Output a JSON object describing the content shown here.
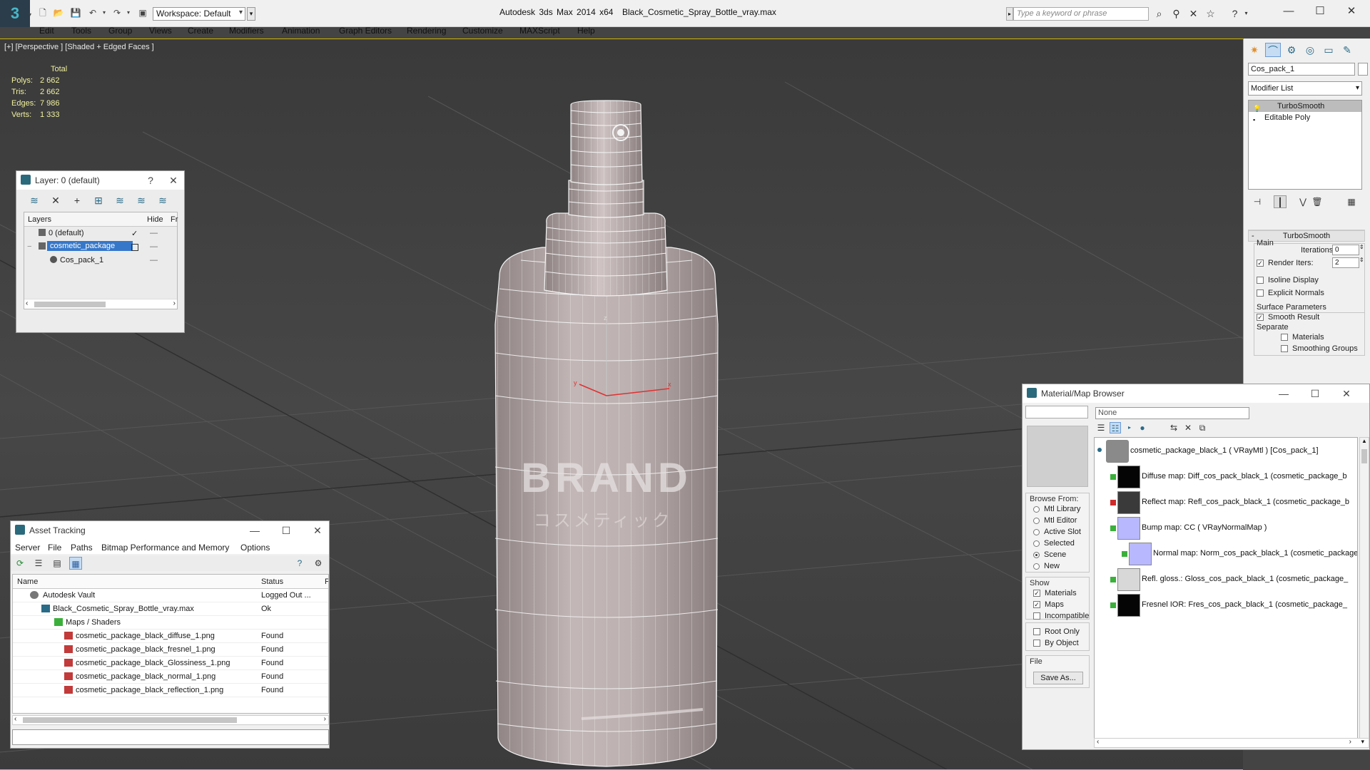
{
  "titlebar": {
    "app_title": "Autodesk 3ds Max  2014 x64",
    "file_name": "Black_Cosmetic_Spray_Bottle_vray.max",
    "workspace": "Workspace: Default",
    "search_placeholder": "Type a keyword or phrase"
  },
  "menu": [
    "Edit",
    "Tools",
    "Group",
    "Views",
    "Create",
    "Modifiers",
    "Animation",
    "Graph Editors",
    "Rendering",
    "Customize",
    "MAXScript",
    "Help"
  ],
  "viewport": {
    "label": "[+] [Perspective ] [Shaded + Edged Faces ]",
    "stats_header": "Total",
    "stats": [
      {
        "k": "Polys:",
        "v": "2 662"
      },
      {
        "k": "Tris:",
        "v": "2 662"
      },
      {
        "k": "Edges:",
        "v": "7 986"
      },
      {
        "k": "Verts:",
        "v": "1 333"
      }
    ],
    "brand_text": "BRAND",
    "sub_text": "コスメティック",
    "gizmo_z": "z",
    "gizmo_x": "x",
    "gizmo_y": "y"
  },
  "layer_window": {
    "title": "Layer: 0 (default)",
    "help": "?",
    "columns": {
      "layers": "Layers",
      "hide": "Hide",
      "freeze": "Fr"
    },
    "rows": [
      {
        "name": "0 (default)",
        "check": "✓"
      },
      {
        "name": "cosmetic_package"
      },
      {
        "name": "Cos_pack_1"
      }
    ]
  },
  "asset_window": {
    "title": "Asset Tracking",
    "menu": [
      "Server",
      "File",
      "Paths",
      "Bitmap Performance and Memory",
      "Options"
    ],
    "columns": {
      "name": "Name",
      "status": "Status",
      "extra": "F"
    },
    "rows": [
      {
        "name": "Autodesk Vault",
        "status": "Logged Out ..."
      },
      {
        "name": "Black_Cosmetic_Spray_Bottle_vray.max",
        "status": "Ok"
      },
      {
        "name": "Maps / Shaders",
        "status": ""
      },
      {
        "name": "cosmetic_package_black_diffuse_1.png",
        "status": "Found"
      },
      {
        "name": "cosmetic_package_black_fresnel_1.png",
        "status": "Found"
      },
      {
        "name": "cosmetic_package_black_Glossiness_1.png",
        "status": "Found"
      },
      {
        "name": "cosmetic_package_black_normal_1.png",
        "status": "Found"
      },
      {
        "name": "cosmetic_package_black_reflection_1.png",
        "status": "Found"
      }
    ]
  },
  "material_window": {
    "title": "Material/Map Browser",
    "filter": "None",
    "browse_from_label": "Browse From:",
    "browse_from": [
      "Mtl Library",
      "Mtl Editor",
      "Active Slot",
      "Selected",
      "Scene",
      "New"
    ],
    "browse_selected_index": 4,
    "show_label": "Show",
    "show": [
      {
        "label": "Materials",
        "checked": true
      },
      {
        "label": "Maps",
        "checked": true
      },
      {
        "label": "Incompatible",
        "checked": false
      }
    ],
    "extra_checks": [
      "Root Only",
      "By Object"
    ],
    "file_label": "File",
    "save_as": "Save As...",
    "tree": [
      {
        "label": "cosmetic_package_black_1  ( VRayMtl )  [Cos_pack_1]",
        "thumb": "#8a8a8a",
        "link": ""
      },
      {
        "label": "Diffuse map: Diff_cos_pack_black_1 (cosmetic_package_b",
        "thumb": "#050505",
        "link": "#3ab03a"
      },
      {
        "label": "Reflect map: Refl_cos_pack_black_1 (cosmetic_package_b",
        "thumb": "#3a3a3a",
        "link": "#d02b2b"
      },
      {
        "label": "Bump map: CC  ( VRayNormalMap )",
        "thumb": "#b8b8ff",
        "link": "#3ab03a"
      },
      {
        "label": "Normal map: Norm_cos_pack_black_1 (cosmetic_package",
        "thumb": "#b8b8ff",
        "link": "#3ab03a"
      },
      {
        "label": "Refl. gloss.: Gloss_cos_pack_black_1 (cosmetic_package_",
        "thumb": "#d8d8d8",
        "link": "#3ab03a"
      },
      {
        "label": "Fresnel IOR: Fres_cos_pack_black_1 (cosmetic_package_",
        "thumb": "#050505",
        "link": "#3ab03a"
      }
    ]
  },
  "command_panel": {
    "object_name": "Cos_pack_1",
    "modifier_list": "Modifier List",
    "stack": [
      "TurboSmooth",
      "Editable Poly"
    ],
    "rollout_title": "TurboSmooth",
    "main_label": "Main",
    "iterations_label": "Iterations:",
    "iterations_value": "0",
    "render_iters_label": "Render Iters:",
    "render_iters_value": "2",
    "isoline_label": "Isoline Display",
    "explicit_normals_label": "Explicit Normals",
    "surface_params_label": "Surface Parameters",
    "smooth_result_label": "Smooth Result",
    "separate_label": "Separate",
    "materials_label": "Materials",
    "smoothing_groups_label": "Smoothing Groups"
  }
}
